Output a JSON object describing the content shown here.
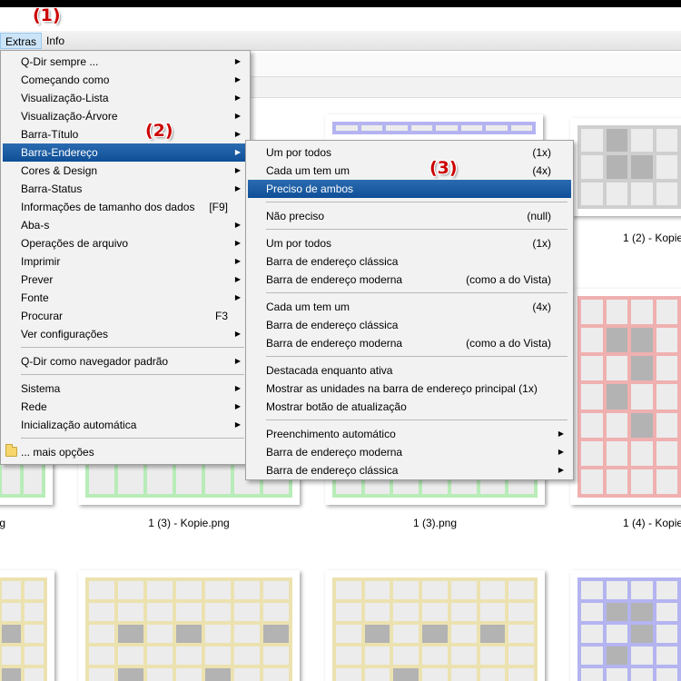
{
  "menubar": {
    "extras": "Extras",
    "info": "Info"
  },
  "annotations": {
    "a1": "(1)",
    "a2": "(2)",
    "a3": "(3)"
  },
  "thumbnails": {
    "captions": [
      "1 (2) - Kopie",
      "1 (3) - Kopie.png",
      "1 (3).png",
      "1 (4) - Kopie",
      "g"
    ]
  },
  "extras_menu": {
    "items": [
      {
        "label": "Q-Dir sempre ...",
        "shortcut": ""
      },
      {
        "label": "Começando como",
        "shortcut": ""
      },
      {
        "label": "Visualização-Lista",
        "shortcut": ""
      },
      {
        "label": "Visualização-Árvore",
        "shortcut": ""
      },
      {
        "label": "Barra-Título",
        "shortcut": ""
      },
      {
        "label": "Barra-Endereço",
        "shortcut": ""
      },
      {
        "label": "Cores & Design",
        "shortcut": ""
      },
      {
        "label": "Barra-Status",
        "shortcut": ""
      },
      {
        "label": "Informações de tamanho dos dados",
        "shortcut": "[F9]"
      },
      {
        "label": "Aba-s",
        "shortcut": ""
      },
      {
        "label": "Operações de arquivo",
        "shortcut": ""
      },
      {
        "label": "Imprimir",
        "shortcut": ""
      },
      {
        "label": "Prever",
        "shortcut": ""
      },
      {
        "label": "Fonte",
        "shortcut": ""
      },
      {
        "label": "Procurar",
        "shortcut": "F3"
      },
      {
        "label": "Ver configurações",
        "shortcut": ""
      },
      {
        "label": "Q-Dir como navegador padrão",
        "shortcut": ""
      },
      {
        "label": "Sistema",
        "shortcut": ""
      },
      {
        "label": "Rede",
        "shortcut": ""
      },
      {
        "label": "Inicialização automática",
        "shortcut": ""
      },
      {
        "label": "... mais opções",
        "shortcut": ""
      }
    ]
  },
  "address_submenu": {
    "items": [
      {
        "label": "Um por todos",
        "shortcut": "(1x)"
      },
      {
        "label": "Cada um tem um",
        "shortcut": "(4x)"
      },
      {
        "label": "Preciso de ambos",
        "shortcut": ""
      },
      {
        "label": "Não preciso",
        "shortcut": "(null)"
      },
      {
        "label": "Um por todos",
        "shortcut": "(1x)"
      },
      {
        "label": "Barra de endereço clássica",
        "shortcut": ""
      },
      {
        "label": "Barra de endereço moderna",
        "shortcut": "(como a do Vista)"
      },
      {
        "label": "Cada um tem um",
        "shortcut": "(4x)"
      },
      {
        "label": "Barra de endereço clássica",
        "shortcut": ""
      },
      {
        "label": "Barra de endereço moderna",
        "shortcut": "(como a do Vista)"
      },
      {
        "label": "Destacada enquanto ativa",
        "shortcut": ""
      },
      {
        "label": "Mostrar as unidades na barra de endereço principal (1x)",
        "shortcut": ""
      },
      {
        "label": "Mostrar botão de atualização",
        "shortcut": ""
      },
      {
        "label": "Preenchimento automático",
        "shortcut": ""
      },
      {
        "label": "Barra de endereço moderna",
        "shortcut": ""
      },
      {
        "label": "Barra de endereço clássica",
        "shortcut": ""
      }
    ]
  },
  "colors": {
    "highlight": "#1a5ea8",
    "annotation": "#cc0000"
  }
}
